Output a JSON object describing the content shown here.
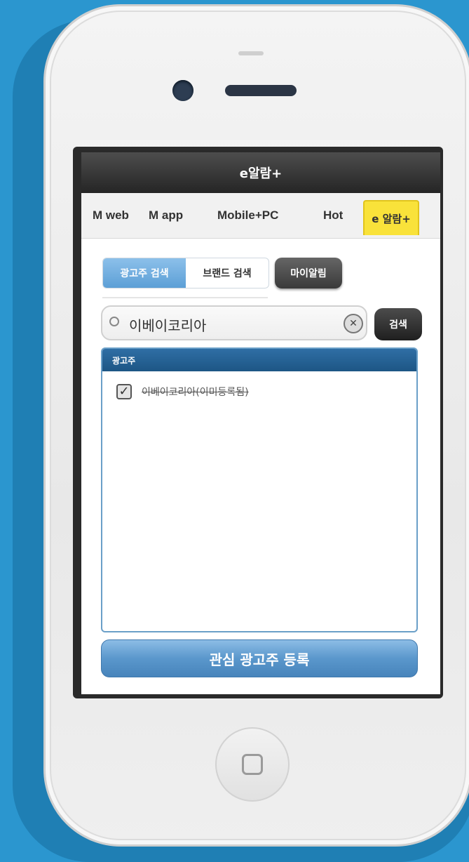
{
  "app": {
    "title": "e알람+"
  },
  "tabs": [
    {
      "label": "M web"
    },
    {
      "label": "M app"
    },
    {
      "label": "Mobile+PC"
    },
    {
      "label": "Hot"
    },
    {
      "label": "e 알람+"
    }
  ],
  "segment": {
    "left_label": "광고주 검색",
    "right_label": "브랜드 검색"
  },
  "my_alarm_label": "마이알림",
  "search": {
    "value": "이베이코리아",
    "button_label": "검색"
  },
  "list": {
    "header": "광고주",
    "items": [
      {
        "label": "이베이코리아(이미등록됨)",
        "checked": true
      }
    ]
  },
  "register_button_label": "관심 광고주 등록",
  "colors": {
    "background": "#2b96cf",
    "active_tab": "#f9e23a",
    "accent_blue": "#5c9fd6"
  },
  "icons": [
    "search-icon",
    "clear-icon",
    "checkbox-check-icon",
    "home-button-icon"
  ]
}
